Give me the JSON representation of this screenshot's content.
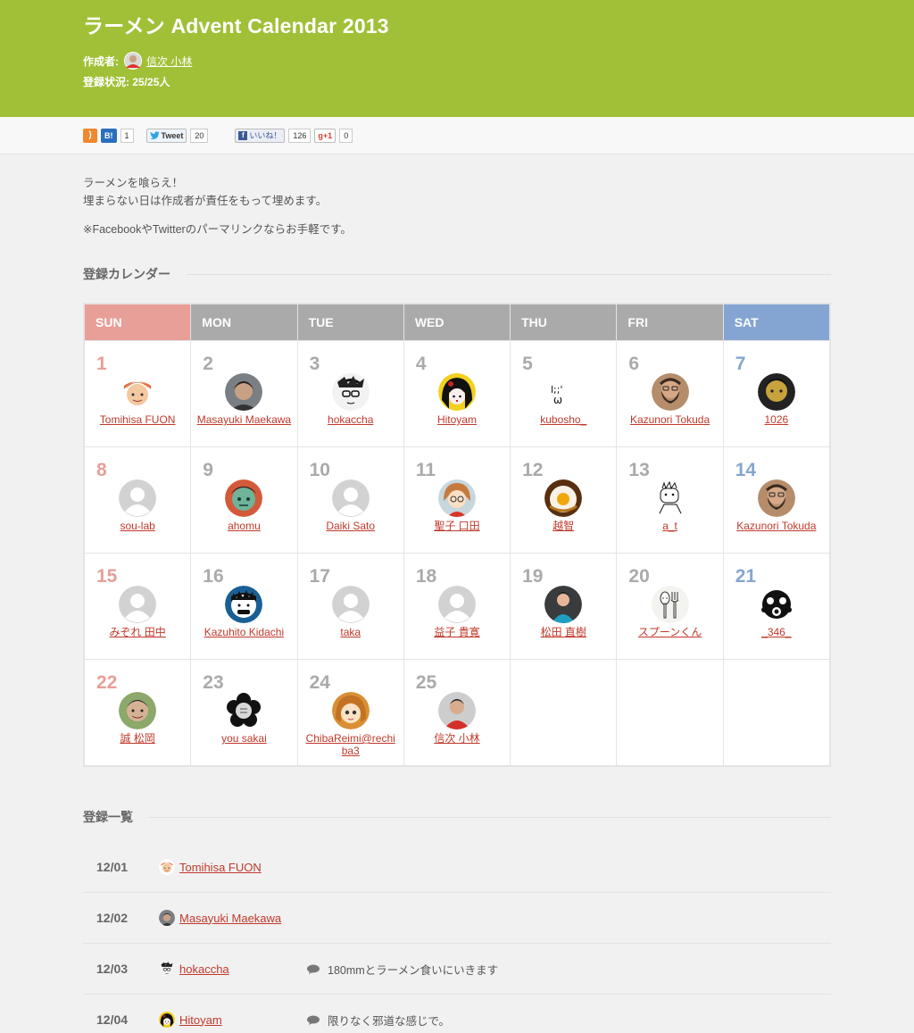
{
  "header": {
    "title": "ラーメン Advent Calendar 2013",
    "author_label": "作成者:",
    "author_name": "信次 小林",
    "status_label": "登録状況:",
    "status_value": "25/25人"
  },
  "sharebar": {
    "hatena_label": "B!",
    "hatena_count": "1",
    "tweet_label": "Tweet",
    "tweet_count": "20",
    "fb_label": "いいね！",
    "fb_count": "126",
    "gplus_label": "g+1",
    "gplus_count": "0"
  },
  "intro": {
    "line1": "ラーメンを喰らえ！",
    "line2": "埋まらない日は作成者が責任をもって埋めます。",
    "line3": "※FacebookやTwitterのパーマリンクならお手軽です。"
  },
  "calendar_title": "登録カレンダー",
  "weekdays": [
    "SUN",
    "MON",
    "TUE",
    "WED",
    "THU",
    "FRI",
    "SAT"
  ],
  "weeks": [
    [
      {
        "day": "1",
        "name": "Tomihisa FUON",
        "avatar": "orange-hair"
      },
      {
        "day": "2",
        "name": "Masayuki Maekawa",
        "avatar": "dark-hair"
      },
      {
        "day": "3",
        "name": "hokaccha",
        "avatar": "glasses-sketch"
      },
      {
        "day": "4",
        "name": "Hitoyam",
        "avatar": "doll"
      },
      {
        "day": "5",
        "name": "kubosho_",
        "avatar": "text-face"
      },
      {
        "day": "6",
        "name": "Kazunori Tokuda",
        "avatar": "beard"
      },
      {
        "day": "7",
        "name": "1026",
        "avatar": "dark-face"
      }
    ],
    [
      {
        "day": "8",
        "name": "sou-lab",
        "avatar": "default"
      },
      {
        "day": "9",
        "name": "ahomu",
        "avatar": "green-face"
      },
      {
        "day": "10",
        "name": "Daiki Sato",
        "avatar": "default"
      },
      {
        "day": "11",
        "name": "聖子 口田",
        "avatar": "illustrated-girl"
      },
      {
        "day": "12",
        "name": "越智",
        "avatar": "egg"
      },
      {
        "day": "13",
        "name": "a_t",
        "avatar": "line-sketch"
      },
      {
        "day": "14",
        "name": "Kazunori Tokuda",
        "avatar": "beard"
      }
    ],
    [
      {
        "day": "15",
        "name": "みぞれ 田中",
        "avatar": "default"
      },
      {
        "day": "16",
        "name": "Kazuhito Kidachi",
        "avatar": "blue-cartoon"
      },
      {
        "day": "17",
        "name": "taka",
        "avatar": "default"
      },
      {
        "day": "18",
        "name": "益子 貴寛",
        "avatar": "default"
      },
      {
        "day": "19",
        "name": "松田 直樹",
        "avatar": "person-photo"
      },
      {
        "day": "20",
        "name": "スプーンくん",
        "avatar": "spoon"
      },
      {
        "day": "21",
        "name": "_346_",
        "avatar": "gas-mask"
      }
    ],
    [
      {
        "day": "22",
        "name": "誠 松岡",
        "avatar": "child-photo"
      },
      {
        "day": "23",
        "name": "you sakai",
        "avatar": "black-flower"
      },
      {
        "day": "24",
        "name": "ChibaReimi@rechiba3",
        "avatar": "cartoon-woman"
      },
      {
        "day": "25",
        "name": "信次 小林",
        "avatar": "red-shirt"
      },
      null,
      null,
      null
    ]
  ],
  "list_title": "登録一覧",
  "entries": [
    {
      "date": "12/01",
      "name": "Tomihisa FUON",
      "avatar": "orange-hair",
      "comment": ""
    },
    {
      "date": "12/02",
      "name": "Masayuki Maekawa",
      "avatar": "dark-hair",
      "comment": ""
    },
    {
      "date": "12/03",
      "name": "hokaccha",
      "avatar": "glasses-sketch",
      "comment": "180mmとラーメン食いにいきます"
    },
    {
      "date": "12/04",
      "name": "Hitoyam",
      "avatar": "doll",
      "comment": "限りなく邪道な感じで。"
    }
  ]
}
